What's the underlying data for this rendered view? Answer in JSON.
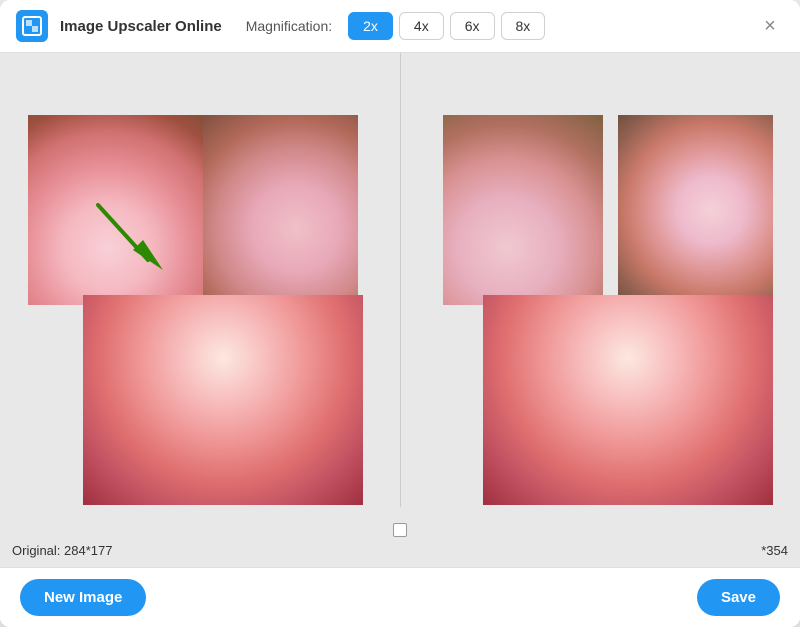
{
  "app": {
    "title": "Image Upscaler Online",
    "icon_label": "app-icon"
  },
  "toolbar": {
    "magnification_label": "Magnification:",
    "mag_buttons": [
      {
        "label": "2x",
        "value": "2x",
        "active": true
      },
      {
        "label": "4x",
        "value": "4x",
        "active": false
      },
      {
        "label": "6x",
        "value": "6x",
        "active": false
      },
      {
        "label": "8x",
        "value": "8x",
        "active": false
      }
    ],
    "close_label": "×"
  },
  "left_panel": {
    "info_text": "Original: 284*177"
  },
  "right_panel": {
    "info_text": "*354"
  },
  "bottom_bar": {
    "new_image_label": "New Image",
    "save_label": "Save"
  }
}
